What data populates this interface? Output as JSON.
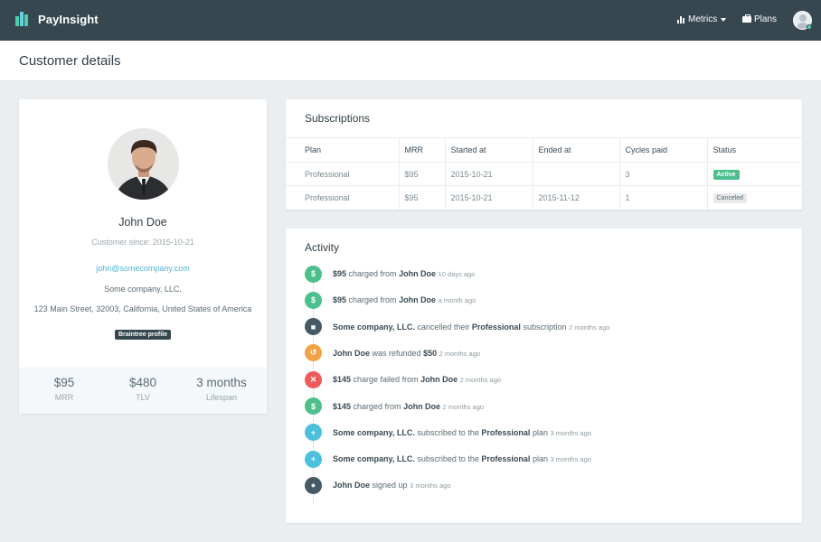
{
  "navbar": {
    "brand": "PayInsight",
    "metrics_label": "Metrics",
    "plans_label": "Plans"
  },
  "page": {
    "title": "Customer details"
  },
  "profile": {
    "name": "John Doe",
    "customer_since": "Customer since: 2015-10-21",
    "email": "john@somecompany.com",
    "company": "Some company, LLC.",
    "address": "123 Main Street, 32003, California, United States of America",
    "badge": "Braintree profile",
    "stats": [
      {
        "value": "$95",
        "label": "MRR"
      },
      {
        "value": "$480",
        "label": "TLV"
      },
      {
        "value": "3 months",
        "label": "Lifespan"
      }
    ]
  },
  "subscriptions": {
    "title": "Subscriptions",
    "columns": [
      "Plan",
      "MRR",
      "Started at",
      "Ended at",
      "Cycles paid",
      "Status"
    ],
    "rows": [
      {
        "plan": "Professional",
        "mrr": "$95",
        "started": "2015-10-21",
        "ended": "",
        "cycles": "3",
        "status": "Active"
      },
      {
        "plan": "Professional",
        "mrr": "$95",
        "started": "2015-10-21",
        "ended": "2015-11-12",
        "cycles": "1",
        "status": "Canceled"
      }
    ]
  },
  "activity": {
    "title": "Activity",
    "items": [
      {
        "icon": "dollar-icon",
        "glyph": "$",
        "color": "#4dbf8d",
        "time": "10 days ago",
        "parts": [
          {
            "b": "$95"
          },
          {
            "t": " charged from "
          },
          {
            "b": "John Doe"
          }
        ]
      },
      {
        "icon": "dollar-icon",
        "glyph": "$",
        "color": "#4dbf8d",
        "time": "a month ago",
        "parts": [
          {
            "b": "$95"
          },
          {
            "t": " charged from "
          },
          {
            "b": "John Doe"
          }
        ]
      },
      {
        "icon": "trash-icon",
        "glyph": "■",
        "color": "#455a64",
        "time": "2 months ago",
        "parts": [
          {
            "b": "Some company, LLC."
          },
          {
            "t": " cancelled their "
          },
          {
            "b": "Professional"
          },
          {
            "t": " subscription"
          }
        ]
      },
      {
        "icon": "refund-icon",
        "glyph": "↺",
        "color": "#f2a245",
        "time": "2 months ago",
        "parts": [
          {
            "b": "John Doe"
          },
          {
            "t": " was refunded "
          },
          {
            "b": "$50"
          }
        ]
      },
      {
        "icon": "x-icon",
        "glyph": "✕",
        "color": "#ef5b5b",
        "time": "2 months ago",
        "parts": [
          {
            "b": "$145"
          },
          {
            "t": " charge failed from "
          },
          {
            "b": "John Doe"
          }
        ]
      },
      {
        "icon": "dollar-icon",
        "glyph": "$",
        "color": "#4dbf8d",
        "time": "2 months ago",
        "parts": [
          {
            "b": "$145"
          },
          {
            "t": " charged from "
          },
          {
            "b": "John Doe"
          }
        ]
      },
      {
        "icon": "plus-icon",
        "glyph": "+",
        "color": "#4cc0dc",
        "time": "3 months ago",
        "parts": [
          {
            "b": "Some company, LLC."
          },
          {
            "t": " subscribed to the "
          },
          {
            "b": "Professional"
          },
          {
            "t": " plan"
          }
        ]
      },
      {
        "icon": "plus-icon",
        "glyph": "+",
        "color": "#4cc0dc",
        "time": "3 months ago",
        "parts": [
          {
            "b": "Some company, LLC."
          },
          {
            "t": " subscribed to the "
          },
          {
            "b": "Professional"
          },
          {
            "t": " plan"
          }
        ]
      },
      {
        "icon": "user-icon",
        "glyph": "●",
        "color": "#455a64",
        "time": "3 months ago",
        "parts": [
          {
            "b": "John Doe"
          },
          {
            "t": " signed up"
          }
        ]
      }
    ]
  }
}
